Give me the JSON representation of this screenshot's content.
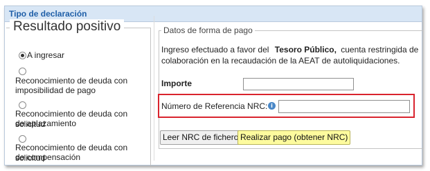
{
  "header": {
    "title": "Tipo de declaración"
  },
  "left": {
    "legend": "Resultado positivo",
    "options": [
      {
        "label": "A ingresar",
        "checked": true
      },
      {
        "label_line1": "Reconocimiento de deuda con",
        "label_line2": "imposibilidad de pago",
        "checked": false
      },
      {
        "label_line1": "Reconocimiento de deuda con solicitud",
        "label_line2": "de aplazamiento",
        "checked": false
      },
      {
        "label_line1": "Reconocimiento de deuda con solicitud",
        "label_line2": "de compensación",
        "checked": false
      }
    ]
  },
  "payment": {
    "legend": "Datos de forma de pago",
    "desc_part1": "Ingreso efectuado a favor del",
    "desc_bold": "Tesoro Público,",
    "desc_part2": "cuenta restringida de",
    "desc_line2": "colaboración en la recaudación de la AEAT de autoliquidaciones.",
    "importe_label": "Importe",
    "importe_value": "",
    "nrc_label": "Número de Referencia  NRC:",
    "nrc_value": "",
    "info_icon": "info-icon",
    "buttons": {
      "leer_nrc": "Leer NRC de fichero",
      "realizar_pago": "Realizar pago (obtener NRC)"
    }
  },
  "colors": {
    "header_bg": "#d8e6f5",
    "header_text": "#1f5fa8",
    "highlight_border": "#d9232d",
    "primary_button_bg": "#fdfb9e"
  }
}
